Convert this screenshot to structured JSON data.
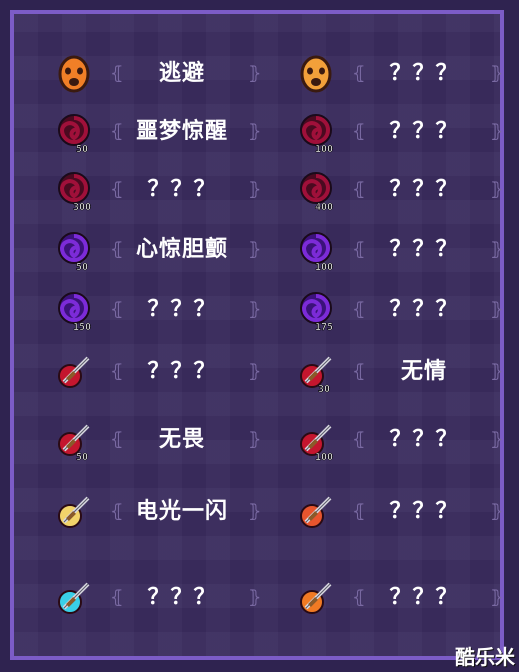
{
  "achievements": [
    {
      "icon": "orange-mask-icon",
      "label": "逃避"
    },
    {
      "icon": "gold-mask-icon",
      "label": "？？？"
    },
    {
      "icon": "red-vortex-50-icon",
      "label": "噩梦惊醒"
    },
    {
      "icon": "red-vortex-100-icon",
      "label": "？？？"
    },
    {
      "icon": "red-vortex-300-icon",
      "label": "？？？"
    },
    {
      "icon": "red-vortex-400-icon",
      "label": "？？？"
    },
    {
      "icon": "purple-vortex-50-icon",
      "label": "心惊胆颤"
    },
    {
      "icon": "purple-vortex-100-icon",
      "label": "？？？"
    },
    {
      "icon": "purple-vortex-150-icon",
      "label": "？？？"
    },
    {
      "icon": "purple-vortex-175-icon",
      "label": "？？？"
    },
    {
      "icon": "dagger-icon",
      "label": "？？？"
    },
    {
      "icon": "dagger-30-icon",
      "label": "无情"
    },
    {
      "icon": "dagger-50-icon",
      "label": "无畏"
    },
    {
      "icon": "dagger-100-icon",
      "label": "？？？"
    },
    {
      "icon": "lightning-dagger-icon",
      "label": "电光一闪"
    },
    {
      "icon": "fire-dagger-icon",
      "label": "？？？"
    },
    {
      "icon": "ice-dagger-icon",
      "label": "？？？"
    },
    {
      "icon": "flame-dagger-icon",
      "label": "？？？"
    }
  ],
  "icon_badges": {
    "red-vortex-50-icon": "50",
    "red-vortex-100-icon": "100",
    "red-vortex-300-icon": "300",
    "red-vortex-400-icon": "400",
    "purple-vortex-50-icon": "50",
    "purple-vortex-100-icon": "100",
    "purple-vortex-150-icon": "150",
    "purple-vortex-175-icon": "175",
    "dagger-30-icon": "30",
    "dagger-50-icon": "50",
    "dagger-100-icon": "100"
  },
  "watermark": "酷乐米",
  "colors": {
    "background": "#2f2350",
    "panel": "#3a2c5e",
    "border": "#7c5cc7",
    "text": "#ffffff",
    "bracket": "#7a6aa3"
  }
}
